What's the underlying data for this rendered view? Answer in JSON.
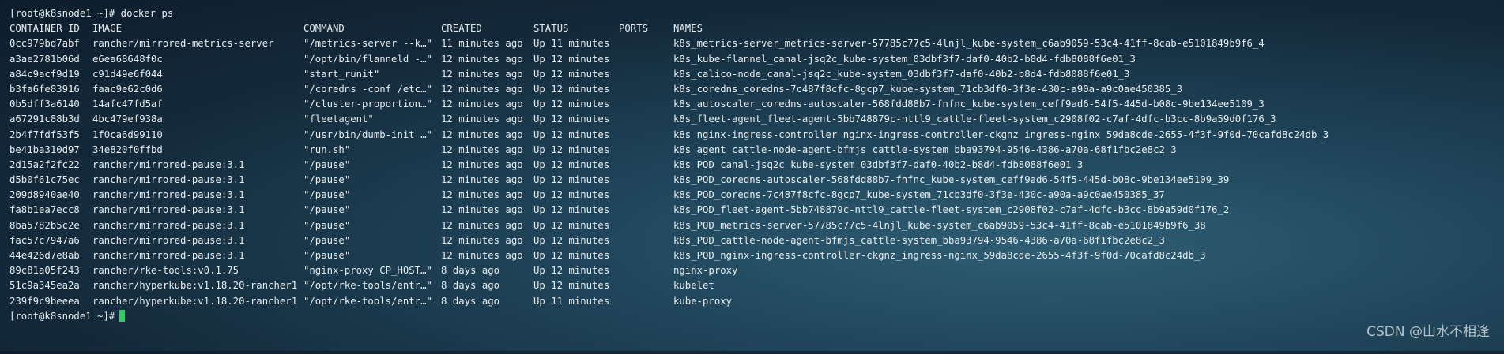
{
  "terminal": {
    "first_prompt": "[root@k8snode1 ~]# docker ps",
    "last_prompt": "[root@k8snode1 ~]#",
    "headers": [
      "CONTAINER ID",
      "IMAGE",
      "COMMAND",
      "CREATED",
      "STATUS",
      "PORTS",
      "NAMES"
    ],
    "rows": [
      [
        "0cc979bd7abf",
        "rancher/mirrored-metrics-server",
        "\"/metrics-server --k…\"",
        "11 minutes ago",
        "Up 11 minutes",
        "",
        "k8s_metrics-server_metrics-server-57785c77c5-4lnjl_kube-system_c6ab9059-53c4-41ff-8cab-e5101849b9f6_4"
      ],
      [
        "a3ae2781b06d",
        "e6ea68648f0c",
        "\"/opt/bin/flanneld -…\"",
        "12 minutes ago",
        "Up 12 minutes",
        "",
        "k8s_kube-flannel_canal-jsq2c_kube-system_03dbf3f7-daf0-40b2-b8d4-fdb8088f6e01_3"
      ],
      [
        "a84c9acf9d19",
        "c91d49e6f044",
        "\"start_runit\"",
        "12 minutes ago",
        "Up 12 minutes",
        "",
        "k8s_calico-node_canal-jsq2c_kube-system_03dbf3f7-daf0-40b2-b8d4-fdb8088f6e01_3"
      ],
      [
        "b3fa6fe83916",
        "faac9e62c0d6",
        "\"/coredns -conf /etc…\"",
        "12 minutes ago",
        "Up 12 minutes",
        "",
        "k8s_coredns_coredns-7c487f8cfc-8gcp7_kube-system_71cb3df0-3f3e-430c-a90a-a9c0ae450385_3"
      ],
      [
        "0b5dff3a6140",
        "14afc47fd5af",
        "\"/cluster-proportion…\"",
        "12 minutes ago",
        "Up 12 minutes",
        "",
        "k8s_autoscaler_coredns-autoscaler-568fdd88b7-fnfnc_kube-system_ceff9ad6-54f5-445d-b08c-9be134ee5109_3"
      ],
      [
        "a67291c88b3d",
        "4bc479ef938a",
        "\"fleetagent\"",
        "12 minutes ago",
        "Up 12 minutes",
        "",
        "k8s_fleet-agent_fleet-agent-5bb748879c-nttl9_cattle-fleet-system_c2908f02-c7af-4dfc-b3cc-8b9a59d0f176_3"
      ],
      [
        "2b4f7fdf53f5",
        "1f0ca6d99110",
        "\"/usr/bin/dumb-init …\"",
        "12 minutes ago",
        "Up 12 minutes",
        "",
        "k8s_nginx-ingress-controller_nginx-ingress-controller-ckgnz_ingress-nginx_59da8cde-2655-4f3f-9f0d-70cafd8c24db_3"
      ],
      [
        "be41ba310d97",
        "34e820f0ffbd",
        "\"run.sh\"",
        "12 minutes ago",
        "Up 12 minutes",
        "",
        "k8s_agent_cattle-node-agent-bfmjs_cattle-system_bba93794-9546-4386-a70a-68f1fbc2e8c2_3"
      ],
      [
        "2d15a2f2fc22",
        "rancher/mirrored-pause:3.1",
        "\"/pause\"",
        "12 minutes ago",
        "Up 12 minutes",
        "",
        "k8s_POD_canal-jsq2c_kube-system_03dbf3f7-daf0-40b2-b8d4-fdb8088f6e01_3"
      ],
      [
        "d5b0f61c75ec",
        "rancher/mirrored-pause:3.1",
        "\"/pause\"",
        "12 minutes ago",
        "Up 12 minutes",
        "",
        "k8s_POD_coredns-autoscaler-568fdd88b7-fnfnc_kube-system_ceff9ad6-54f5-445d-b08c-9be134ee5109_39"
      ],
      [
        "209d8940ae40",
        "rancher/mirrored-pause:3.1",
        "\"/pause\"",
        "12 minutes ago",
        "Up 12 minutes",
        "",
        "k8s_POD_coredns-7c487f8cfc-8gcp7_kube-system_71cb3df0-3f3e-430c-a90a-a9c0ae450385_37"
      ],
      [
        "fa8b1ea7ecc8",
        "rancher/mirrored-pause:3.1",
        "\"/pause\"",
        "12 minutes ago",
        "Up 12 minutes",
        "",
        "k8s_POD_fleet-agent-5bb748879c-nttl9_cattle-fleet-system_c2908f02-c7af-4dfc-b3cc-8b9a59d0f176_2"
      ],
      [
        "8ba5782b5c2e",
        "rancher/mirrored-pause:3.1",
        "\"/pause\"",
        "12 minutes ago",
        "Up 12 minutes",
        "",
        "k8s_POD_metrics-server-57785c77c5-4lnjl_kube-system_c6ab9059-53c4-41ff-8cab-e5101849b9f6_38"
      ],
      [
        "fac57c7947a6",
        "rancher/mirrored-pause:3.1",
        "\"/pause\"",
        "12 minutes ago",
        "Up 12 minutes",
        "",
        "k8s_POD_cattle-node-agent-bfmjs_cattle-system_bba93794-9546-4386-a70a-68f1fbc2e8c2_3"
      ],
      [
        "44e426d7e8ab",
        "rancher/mirrored-pause:3.1",
        "\"/pause\"",
        "12 minutes ago",
        "Up 12 minutes",
        "",
        "k8s_POD_nginx-ingress-controller-ckgnz_ingress-nginx_59da8cde-2655-4f3f-9f0d-70cafd8c24db_3"
      ],
      [
        "89c81a05f243",
        "rancher/rke-tools:v0.1.75",
        "\"nginx-proxy CP_HOST…\"",
        "8 days ago",
        "Up 12 minutes",
        "",
        "nginx-proxy"
      ],
      [
        "51c9a345ea2a",
        "rancher/hyperkube:v1.18.20-rancher1",
        "\"/opt/rke-tools/entr…\"",
        "8 days ago",
        "Up 12 minutes",
        "",
        "kubelet"
      ],
      [
        "239f9c9beeea",
        "rancher/hyperkube:v1.18.20-rancher1",
        "\"/opt/rke-tools/entr…\"",
        "8 days ago",
        "Up 11 minutes",
        "",
        "kube-proxy"
      ]
    ]
  },
  "watermark": "CSDN @山水不相逢",
  "colors": {
    "text": "#e6ecef",
    "cursor": "#27d35a",
    "background": "#1f4358"
  }
}
